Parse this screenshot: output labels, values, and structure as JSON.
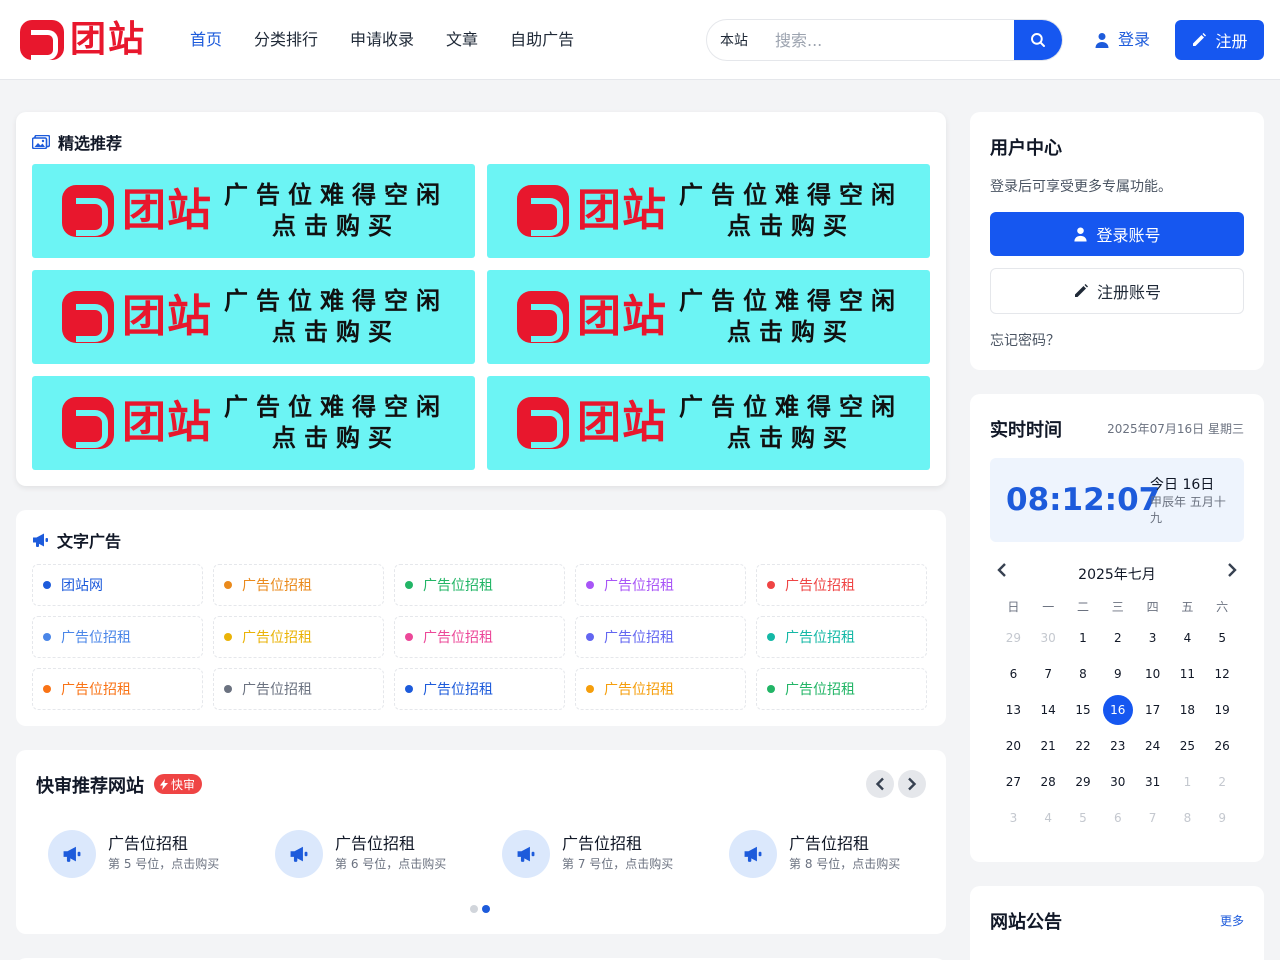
{
  "header": {
    "logo_text": "团站",
    "nav": [
      "首页",
      "分类排行",
      "申请收录",
      "文章",
      "自助广告"
    ],
    "search_scope": "本站",
    "search_placeholder": "搜索...",
    "login_label": "登录",
    "register_label": "注册",
    "accent": "#1657f0"
  },
  "featured": {
    "title": "精选推荐",
    "banners": [
      {
        "logo": "团站",
        "line1": "广告位难得空闲",
        "line2": "点击购买"
      },
      {
        "logo": "团站",
        "line1": "广告位难得空闲",
        "line2": "点击购买"
      },
      {
        "logo": "团站",
        "line1": "广告位难得空闲",
        "line2": "点击购买"
      },
      {
        "logo": "团站",
        "line1": "广告位难得空闲",
        "line2": "点击购买"
      },
      {
        "logo": "团站",
        "line1": "广告位难得空闲",
        "line2": "点击购买"
      },
      {
        "logo": "团站",
        "line1": "广告位难得空闲",
        "line2": "点击购买"
      }
    ]
  },
  "text_ads": {
    "title": "文字广告",
    "items": [
      {
        "label": "团站网",
        "color": "#1d5bdb"
      },
      {
        "label": "广告位招租",
        "color": "#ea8a1c"
      },
      {
        "label": "广告位招租",
        "color": "#22b566"
      },
      {
        "label": "广告位招租",
        "color": "#a855f7"
      },
      {
        "label": "广告位招租",
        "color": "#ef4444"
      },
      {
        "label": "广告位招租",
        "color": "#4a86e8"
      },
      {
        "label": "广告位招租",
        "color": "#eab308"
      },
      {
        "label": "广告位招租",
        "color": "#ec4899"
      },
      {
        "label": "广告位招租",
        "color": "#6366f1"
      },
      {
        "label": "广告位招租",
        "color": "#14b8a6"
      },
      {
        "label": "广告位招租",
        "color": "#f97316"
      },
      {
        "label": "广告位招租",
        "color": "#6b7280"
      },
      {
        "label": "广告位招租",
        "color": "#1d5bdb"
      },
      {
        "label": "广告位招租",
        "color": "#f59e0b"
      },
      {
        "label": "广告位招租",
        "color": "#22b566"
      }
    ]
  },
  "quick_review": {
    "title": "快审推荐网站",
    "badge": "快审",
    "items": [
      {
        "name": "广告位招租",
        "desc": "第 5 号位，点击购买"
      },
      {
        "name": "广告位招租",
        "desc": "第 6 号位，点击购买"
      },
      {
        "name": "广告位招租",
        "desc": "第 7 号位，点击购买"
      },
      {
        "name": "广告位招租",
        "desc": "第 8 号位，点击购买"
      }
    ],
    "page_count": 2,
    "active_page": 2
  },
  "user_center": {
    "title": "用户中心",
    "desc": "登录后可享受更多专属功能。",
    "login_button": "登录账号",
    "register_button": "注册账号",
    "forgot": "忘记密码？"
  },
  "realtime": {
    "title": "实时时间",
    "date": "2025年07月16日 星期三",
    "clock": "08:12:07",
    "today": "今日 16日",
    "lunar": "甲辰年 五月十九",
    "calendar": {
      "month": "2025年七月",
      "weekdays": [
        "日",
        "一",
        "二",
        "三",
        "四",
        "五",
        "六"
      ],
      "days": [
        {
          "d": "29",
          "m": true
        },
        {
          "d": "30",
          "m": true
        },
        {
          "d": "1"
        },
        {
          "d": "2"
        },
        {
          "d": "3"
        },
        {
          "d": "4"
        },
        {
          "d": "5"
        },
        {
          "d": "6"
        },
        {
          "d": "7"
        },
        {
          "d": "8"
        },
        {
          "d": "9"
        },
        {
          "d": "10"
        },
        {
          "d": "11"
        },
        {
          "d": "12"
        },
        {
          "d": "13"
        },
        {
          "d": "14"
        },
        {
          "d": "15"
        },
        {
          "d": "16",
          "today": true
        },
        {
          "d": "17"
        },
        {
          "d": "18"
        },
        {
          "d": "19"
        },
        {
          "d": "20"
        },
        {
          "d": "21"
        },
        {
          "d": "22"
        },
        {
          "d": "23"
        },
        {
          "d": "24"
        },
        {
          "d": "25"
        },
        {
          "d": "26"
        },
        {
          "d": "27"
        },
        {
          "d": "28"
        },
        {
          "d": "29"
        },
        {
          "d": "30"
        },
        {
          "d": "31"
        },
        {
          "d": "1",
          "m": true
        },
        {
          "d": "2",
          "m": true
        },
        {
          "d": "3",
          "m": true
        },
        {
          "d": "4",
          "m": true
        },
        {
          "d": "5",
          "m": true
        },
        {
          "d": "6",
          "m": true
        },
        {
          "d": "7",
          "m": true
        },
        {
          "d": "8",
          "m": true
        },
        {
          "d": "9",
          "m": true
        }
      ]
    }
  },
  "notice": {
    "title": "网站公告",
    "more": "更多"
  }
}
